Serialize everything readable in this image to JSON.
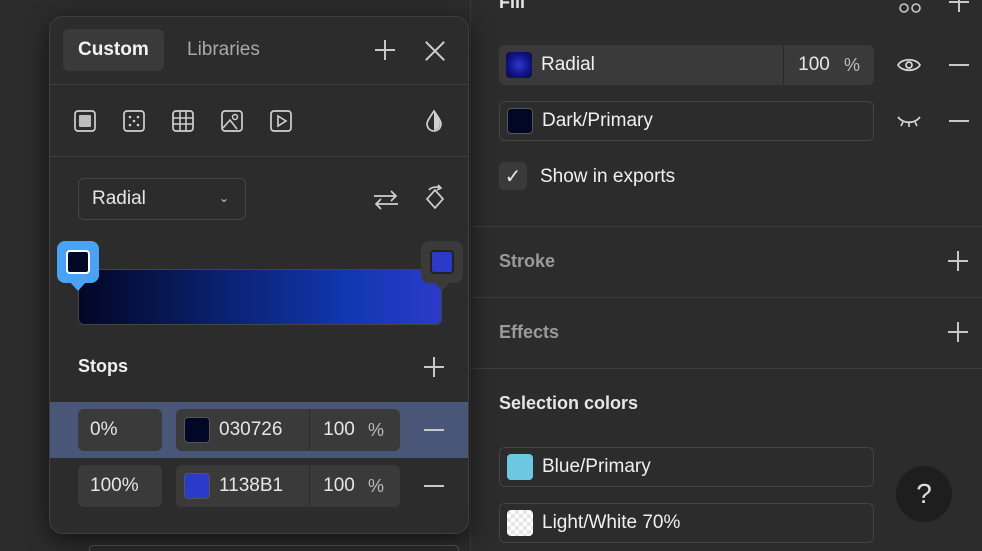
{
  "inspector": {
    "fill_title": "Fill",
    "fill_layers": [
      {
        "name": "Radial",
        "opacity": "100",
        "unit": "%",
        "active": true
      },
      {
        "name": "Dark/Primary",
        "swatch": "#030726"
      }
    ],
    "show_in_exports": "Show in exports",
    "show_in_exports_checked": true,
    "stroke_title": "Stroke",
    "effects_title": "Effects",
    "selection_colors_title": "Selection colors",
    "selection_colors": [
      {
        "name": "Blue/Primary",
        "swatch": "#6cc8e0"
      },
      {
        "name": "Light/White 70%",
        "swatch": "#ffffff"
      }
    ],
    "help_label": "?"
  },
  "picker": {
    "tabs": [
      {
        "label": "Custom",
        "active": true
      },
      {
        "label": "Libraries",
        "active": false
      }
    ],
    "gradient_type": "Radial",
    "stops_title": "Stops",
    "stops": [
      {
        "position": "0%",
        "hex": "030726",
        "opacity": "100",
        "unit": "%",
        "color": "#030726",
        "selected": true
      },
      {
        "position": "100%",
        "hex": "1138B1",
        "opacity": "100",
        "unit": "%",
        "color": "#2b3ac8",
        "selected": false
      }
    ]
  }
}
